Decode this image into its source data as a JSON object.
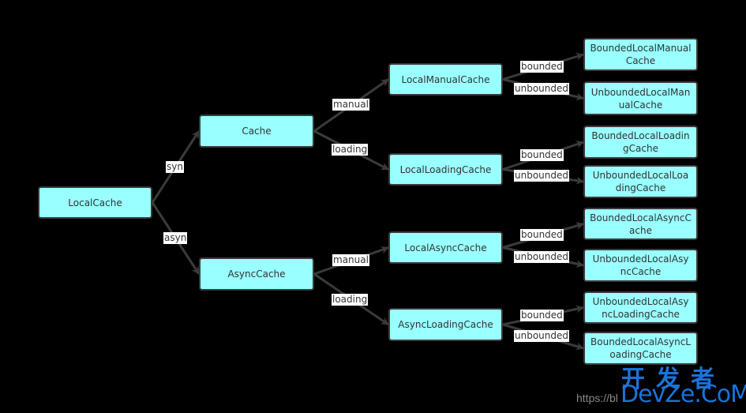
{
  "diagram": {
    "root": {
      "label": "LocalCache"
    },
    "level1": [
      {
        "label": "Cache",
        "edge": "syn"
      },
      {
        "label": "AsyncCache",
        "edge": "asyn"
      }
    ],
    "level2": [
      {
        "label": "LocalManualCache",
        "edge": "manual",
        "parent": "Cache"
      },
      {
        "label": "LocalLoadingCache",
        "edge": "loading",
        "parent": "Cache"
      },
      {
        "label": "LocalAsyncCache",
        "edge": "manual",
        "parent": "AsyncCache"
      },
      {
        "label": "AsyncLoadingCache",
        "edge": "loading",
        "parent": "AsyncCache"
      }
    ],
    "level3": [
      {
        "label": "BoundedLocalManualCache",
        "edge": "bounded",
        "parent": "LocalManualCache"
      },
      {
        "label": "UnboundedLocalManualCache",
        "edge": "unbounded",
        "parent": "LocalManualCache"
      },
      {
        "label": "BoundedLocalLoadingCache",
        "edge": "bounded",
        "parent": "LocalLoadingCache"
      },
      {
        "label": "UnboundedLocalLoadingCache",
        "edge": "unbounded",
        "parent": "LocalLoadingCache"
      },
      {
        "label": "BoundedLocalAsyncCache",
        "edge": "bounded",
        "parent": "LocalAsyncCache"
      },
      {
        "label": "UnboundedLocalAsyncCache",
        "edge": "unbounded",
        "parent": "LocalAsyncCache"
      },
      {
        "label": "UnboundedLocalAsyncLoadingCache",
        "edge": "bounded",
        "parent": "AsyncLoadingCache"
      },
      {
        "label": "BoundedLocalAsyncLoadingCache",
        "edge": "unbounded",
        "parent": "AsyncLoadingCache"
      }
    ],
    "colors": {
      "node_fill": "#99ffff",
      "node_border": "#3a3a3a",
      "edge": "#3a3a3a",
      "background": "#000000"
    }
  },
  "watermark": {
    "chinese": "开发者",
    "brand": "DevZe.CoM",
    "url": "https://bl"
  }
}
